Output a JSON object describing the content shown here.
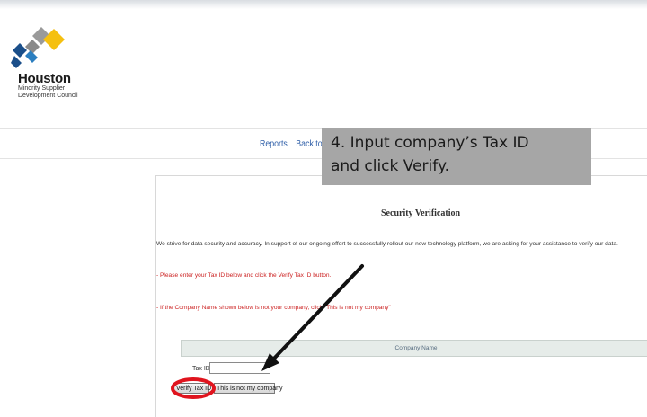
{
  "logo": {
    "name": "Houston",
    "subtitle_lines": [
      "Minority Supplier",
      "Development Council"
    ]
  },
  "nav": {
    "items": [
      "Reports",
      "Back to hmsdc.o"
    ]
  },
  "callout": {
    "lines": [
      "4. Input company’s Tax ID",
      "and click Verify."
    ]
  },
  "security": {
    "title": "Security Verification",
    "intro": "We strive for data security and accuracy. In support of our ongoing effort to successfully rollout our new technology platform, we are asking for your assistance to verify our data.",
    "instruction1": "- Please enter your Tax ID below and click the Verify Tax ID button.",
    "instruction2": "- If the Company Name shown below is not your company, click \"This is not my company\"",
    "company_header": "Company Name",
    "taxid_label": "Tax ID",
    "taxid_value": "",
    "verify_button": "Verify Tax ID",
    "not_mine_button": "This is not my company"
  },
  "colors": {
    "accent_red": "#e0141e",
    "callout_bg": "#a6a6a6",
    "link": "#2f5fa8"
  },
  "icons": [
    "hmsdc-logo-icon",
    "arrow-annotation-icon",
    "highlight-circle-icon"
  ]
}
